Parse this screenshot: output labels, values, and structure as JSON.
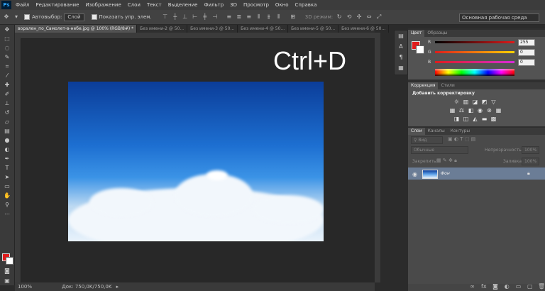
{
  "menubar": {
    "logo": "Ps",
    "items": [
      "Файл",
      "Редактирование",
      "Изображение",
      "Слои",
      "Текст",
      "Выделение",
      "Фильтр",
      "3D",
      "Просмотр",
      "Окно",
      "Справка"
    ]
  },
  "options": {
    "autoselect_label": "Автовыбор:",
    "autoselect_value": "Слой",
    "show_controls_label": "Показать упр. элем.",
    "mode_3d_label": "3D режим:",
    "workspace": "Основная рабочая среда"
  },
  "tabs": [
    "ворален_по_Самолет-в-небе.jpg @ 100% (RGB/8#) *",
    "Без имени-2 @ 50...",
    "Без имени-3 @ 50...",
    "Без имени-4 @ 50...",
    "Без имени-5 @ 50...",
    "Без имени-6 @ 50..."
  ],
  "hint": "Ctrl+D",
  "status": {
    "zoom": "100%",
    "doc": "Док: 750,0K/750,0K"
  },
  "color_panel": {
    "tabs": [
      "Цвет",
      "Образцы"
    ],
    "channels": [
      {
        "label": "R",
        "value": "255",
        "color": "#e01b1b"
      },
      {
        "label": "G",
        "value": "0",
        "color": "#ffd400"
      },
      {
        "label": "B",
        "value": "0",
        "color": "#d82bd8"
      }
    ]
  },
  "adjust_panel": {
    "tabs": [
      "Коррекция",
      "Стили"
    ],
    "title": "Добавить корректировку"
  },
  "layers_panel": {
    "tabs": [
      "Слои",
      "Каналы",
      "Контуры"
    ],
    "kind": "Вид",
    "blend": "Обычные",
    "opacity_label": "Непрозрачность:",
    "opacity": "100%",
    "lock_label": "Закрепить:",
    "fill_label": "Заливка:",
    "fill": "100%",
    "layer_name": "Фон"
  },
  "colors": {
    "accent": "#31a8ff",
    "foreground": "#e01b1b",
    "background": "#ffffff"
  }
}
